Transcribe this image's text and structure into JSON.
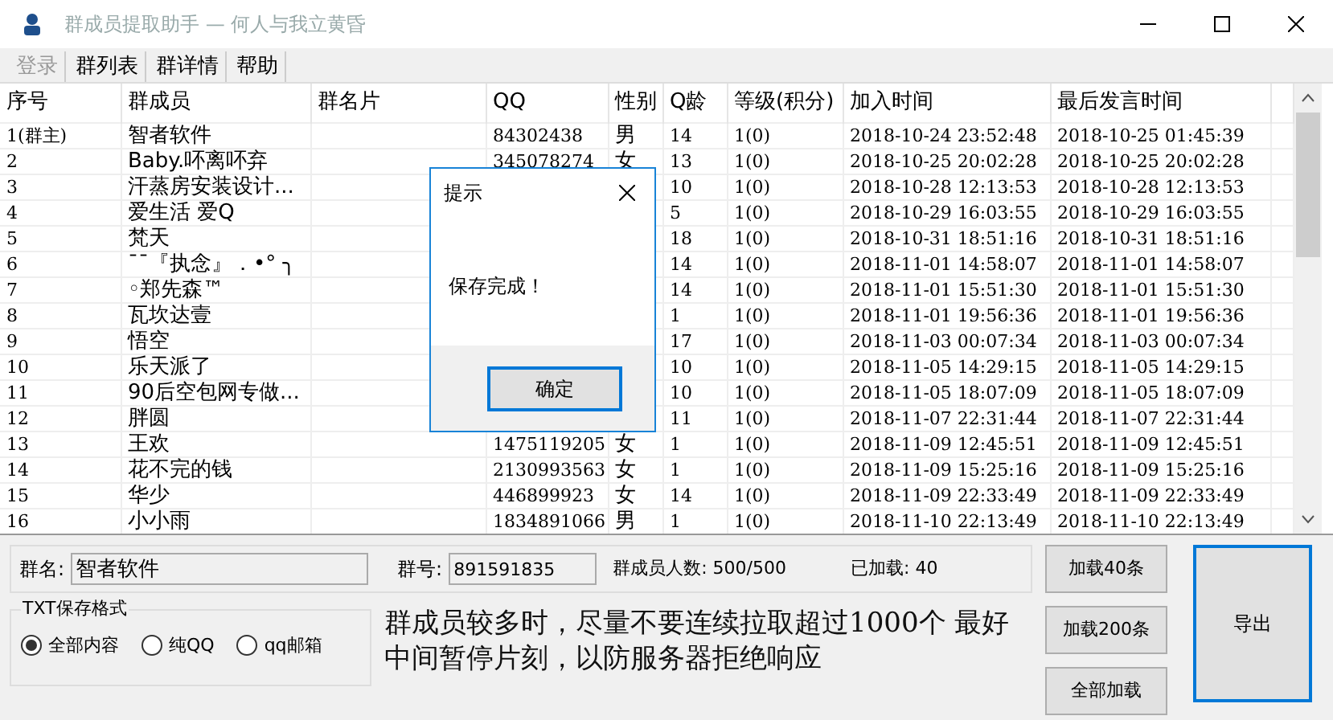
{
  "window": {
    "title": "群成员提取助手 — 何人与我立黄昏"
  },
  "menu": [
    {
      "label": "登录",
      "disabled": true
    },
    {
      "label": "群列表",
      "disabled": false
    },
    {
      "label": "群详情",
      "disabled": false
    },
    {
      "label": "帮助",
      "disabled": false
    }
  ],
  "table": {
    "columns": [
      "序号",
      "群成员",
      "群名片",
      "QQ",
      "性别",
      "Q龄",
      "等级(积分)",
      "加入时间",
      "最后发言时间"
    ],
    "rows": [
      {
        "no": "1(群主)",
        "member": "智者软件",
        "qq": "84302438",
        "sex": "男",
        "age": "14",
        "level": "1(0)",
        "joined": "2018-10-24 23:52:48",
        "last": "2018-10-25 01:45:39"
      },
      {
        "no": "2",
        "member": "Baby.吥离吥弃",
        "qq": "345078274",
        "sex": "女",
        "age": "13",
        "level": "1(0)",
        "joined": "2018-10-25 20:02:28",
        "last": "2018-10-25 20:02:28"
      },
      {
        "no": "3",
        "member": "汗蒸房安装设计...",
        "age": "10",
        "level": "1(0)",
        "joined": "2018-10-28 12:13:53",
        "last": "2018-10-28 12:13:53"
      },
      {
        "no": "4",
        "member": "爱生活 爱Q",
        "age": "5",
        "level": "1(0)",
        "joined": "2018-10-29 16:03:55",
        "last": "2018-10-29 16:03:55"
      },
      {
        "no": "5",
        "member": "梵天",
        "age": "18",
        "level": "1(0)",
        "joined": "2018-10-31 18:51:16",
        "last": "2018-10-31 18:51:16"
      },
      {
        "no": "6",
        "member": "¯¯『执念』．•° ╮",
        "age": "14",
        "level": "1(0)",
        "joined": "2018-11-01 14:58:07",
        "last": "2018-11-01 14:58:07"
      },
      {
        "no": "7",
        "member": "◦郑先森™",
        "age": "14",
        "level": "1(0)",
        "joined": "2018-11-01 15:51:30",
        "last": "2018-11-01 15:51:30"
      },
      {
        "no": "8",
        "member": "瓦坎达壹",
        "age": "1",
        "level": "1(0)",
        "joined": "2018-11-01 19:56:36",
        "last": "2018-11-01 19:56:36"
      },
      {
        "no": "9",
        "member": "悟空",
        "age": "17",
        "level": "1(0)",
        "joined": "2018-11-03 00:07:34",
        "last": "2018-11-03 00:07:34"
      },
      {
        "no": "10",
        "member": "乐天派了",
        "age": "10",
        "level": "1(0)",
        "joined": "2018-11-05 14:29:15",
        "last": "2018-11-05 14:29:15"
      },
      {
        "no": "11",
        "member": "90后空包网专做...",
        "age": "10",
        "level": "1(0)",
        "joined": "2018-11-05 18:07:09",
        "last": "2018-11-05 18:07:09"
      },
      {
        "no": "12",
        "member": "胖圆",
        "age": "11",
        "level": "1(0)",
        "joined": "2018-11-07 22:31:44",
        "last": "2018-11-07 22:31:44"
      },
      {
        "no": "13",
        "member": "王欢",
        "qq": "1475119205",
        "sex": "女",
        "age": "1",
        "level": "1(0)",
        "joined": "2018-11-09 12:45:51",
        "last": "2018-11-09 12:45:51"
      },
      {
        "no": "14",
        "member": "花不完的钱",
        "qq": "2130993563",
        "sex": "女",
        "age": "1",
        "level": "1(0)",
        "joined": "2018-11-09 15:25:16",
        "last": "2018-11-09 15:25:16"
      },
      {
        "no": "15",
        "member": "华少",
        "qq": "446899923",
        "sex": "女",
        "age": "14",
        "level": "1(0)",
        "joined": "2018-11-09 22:33:49",
        "last": "2018-11-09 22:33:49"
      },
      {
        "no": "16",
        "member": "小小雨",
        "qq": "1834891066",
        "sex": "男",
        "age": "1",
        "level": "1(0)",
        "joined": "2018-11-10 22:13:49",
        "last": "2018-11-10 22:13:49"
      }
    ]
  },
  "group": {
    "name_label": "群名:",
    "name": "智者软件",
    "number_label": "群号:",
    "number": "891591835",
    "count": "群成员人数: 500/500",
    "loaded": "已加载: 40"
  },
  "txt_format": {
    "title": "TXT保存格式",
    "options": [
      {
        "label": "全部内容",
        "selected": true
      },
      {
        "label": "纯QQ",
        "selected": false
      },
      {
        "label": "qq邮箱",
        "selected": false
      }
    ]
  },
  "notice": "群成员较多时，尽量不要连续拉取超过1000个 最好中间暂停片刻，以防服务器拒绝响应",
  "load_buttons": [
    "加载40条",
    "加载200条",
    "全部加载"
  ],
  "export_button": "导出",
  "dialog": {
    "title": "提示",
    "message": "保存完成！",
    "button": "确定"
  }
}
